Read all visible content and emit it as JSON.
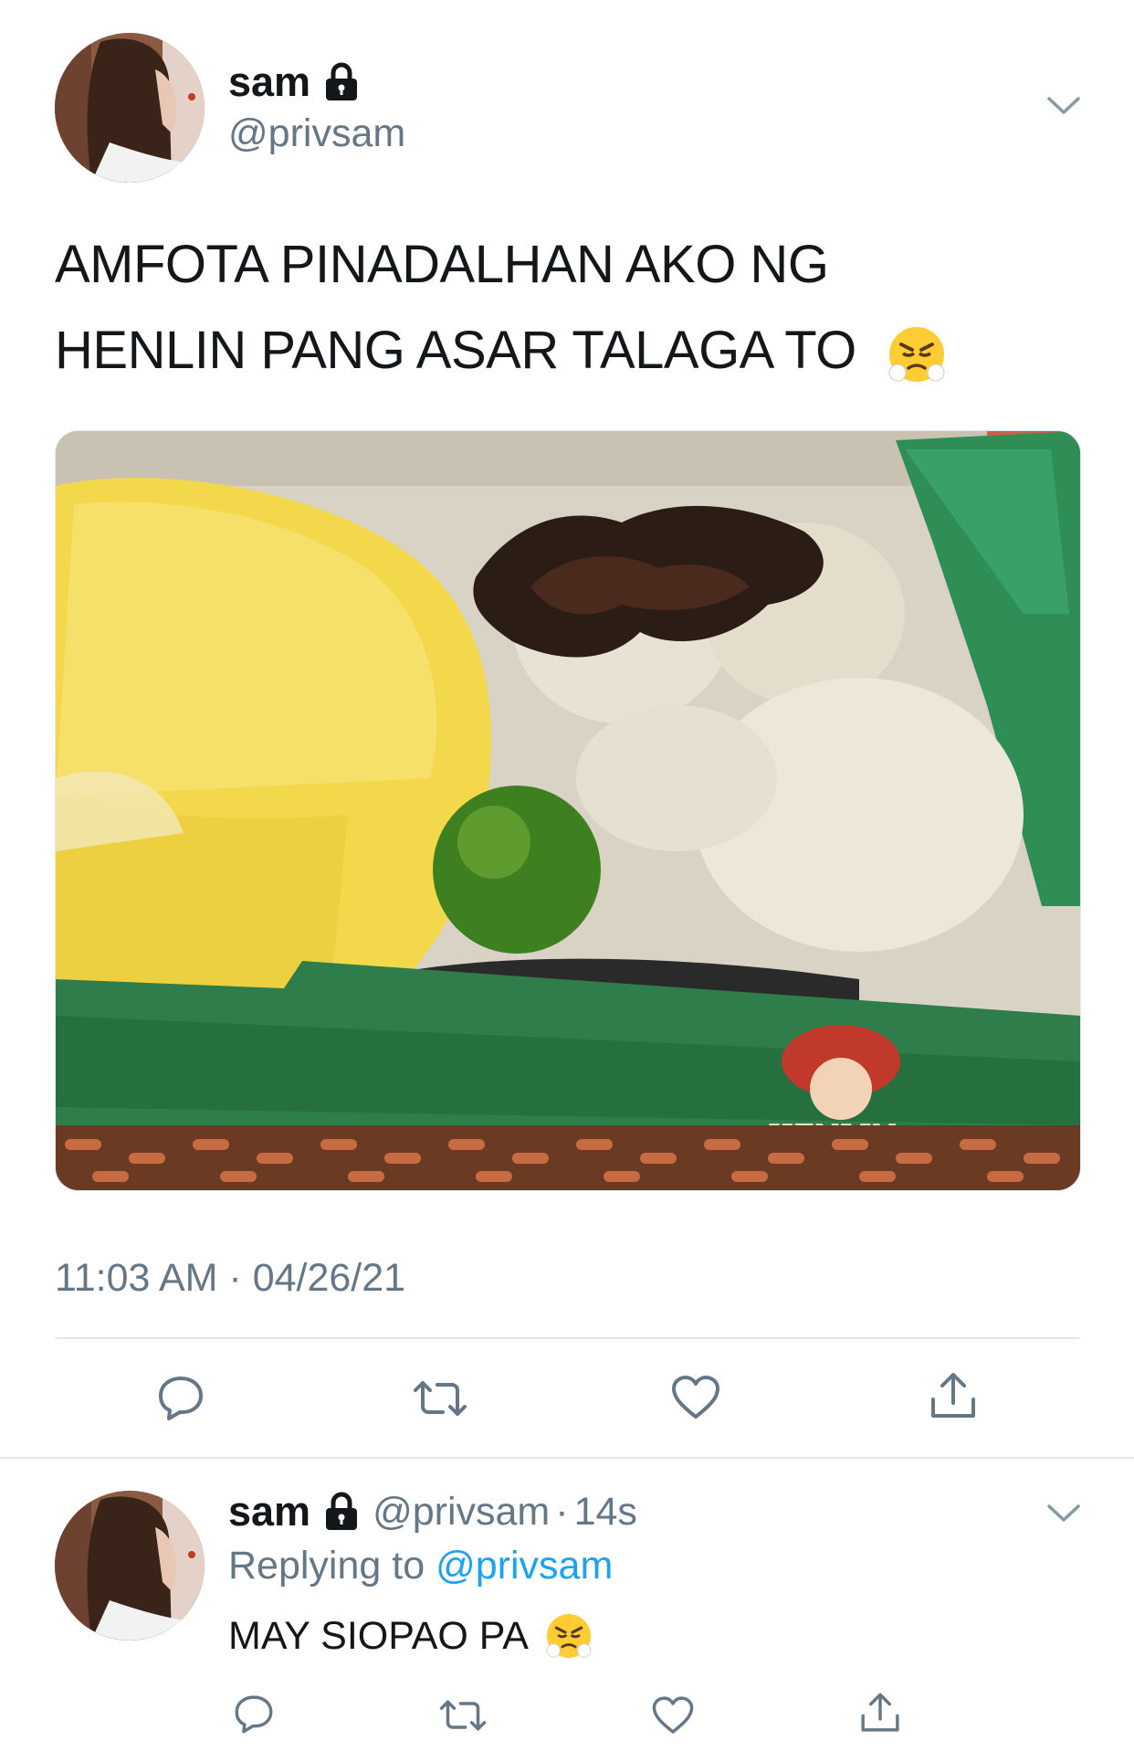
{
  "main_tweet": {
    "name": "sam",
    "handle": "@privsam",
    "text_line1": "AMFOTA PINADALHAN AKO NG",
    "text_line2": "HENLIN PANG ASAR TALAGA TO",
    "emoji": "😤",
    "photo_label": "HENLIN",
    "timestamp": "11:03 AM · 04/26/21"
  },
  "reply_tweet": {
    "name": "sam",
    "handle": "@privsam",
    "dot": "·",
    "time": "14s",
    "replying_prefix": "Replying to",
    "replying_handle": "@privsam",
    "text": "MAY SIOPAO PA",
    "emoji": "😤"
  },
  "icons": {
    "lock": "lock-icon",
    "chevron": "chevron-down-icon",
    "reply": "reply-icon",
    "retweet": "retweet-icon",
    "like": "heart-icon",
    "share": "share-icon"
  },
  "colors": {
    "text": "#14171a",
    "secondary": "#657786",
    "link": "#1da1f2",
    "divider": "#e1e8ed"
  }
}
